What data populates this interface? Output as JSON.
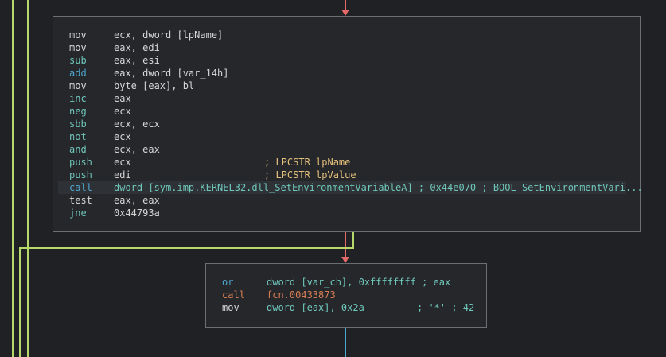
{
  "colors": {
    "background": "#1f2124",
    "node_bg": "#25272b",
    "node_border": "#6b6e72",
    "edge_true": "#b7d86b",
    "edge_false": "#e46a6a",
    "edge_uncond": "#4ea7cf",
    "mnemonic_default": "#d6d6d6",
    "mnemonic_blue": "#4ea7cf",
    "mnemonic_cyan": "#6fc6ba",
    "mnemonic_call_orange": "#d97e53",
    "comment_yellow": "#e5c07b"
  },
  "block1": {
    "lines": [
      {
        "mnemonic": "mov",
        "operand": "ecx, dword [lpName]",
        "comment": ""
      },
      {
        "mnemonic": "mov",
        "operand": "eax, edi",
        "comment": ""
      },
      {
        "mnemonic": "sub",
        "operand": "eax, esi",
        "comment": ""
      },
      {
        "mnemonic": "add",
        "operand": "eax, dword [var_14h]",
        "comment": ""
      },
      {
        "mnemonic": "mov",
        "operand": "byte [eax], bl",
        "comment": ""
      },
      {
        "mnemonic": "inc",
        "operand": "eax",
        "comment": ""
      },
      {
        "mnemonic": "neg",
        "operand": "ecx",
        "comment": ""
      },
      {
        "mnemonic": "sbb",
        "operand": "ecx, ecx",
        "comment": ""
      },
      {
        "mnemonic": "not",
        "operand": "ecx",
        "comment": ""
      },
      {
        "mnemonic": "and",
        "operand": "ecx, eax",
        "comment": ""
      },
      {
        "mnemonic": "push",
        "operand": "ecx",
        "comment": "; LPCSTR lpName"
      },
      {
        "mnemonic": "push",
        "operand": "edi",
        "comment": "; LPCSTR lpValue"
      },
      {
        "mnemonic": "call",
        "operand": "dword [sym.imp.KERNEL32.dll_SetEnvironmentVariableA] ; 0x44e070 ; BOOL SetEnvironmentVari...",
        "comment": ""
      },
      {
        "mnemonic": "test",
        "operand": "eax, eax",
        "comment": ""
      },
      {
        "mnemonic": "jne",
        "operand": "0x44793a",
        "comment": ""
      }
    ]
  },
  "block2": {
    "lines": [
      {
        "mnemonic": "or",
        "operand": "dword [var_ch], 0xffffffff ; eax",
        "comment": ""
      },
      {
        "mnemonic": "call",
        "operand": "fcn.00433873",
        "comment": ""
      },
      {
        "mnemonic": "mov",
        "operand": "dword [eax], 0x2a",
        "comment": "; '*' ; 42"
      }
    ]
  }
}
